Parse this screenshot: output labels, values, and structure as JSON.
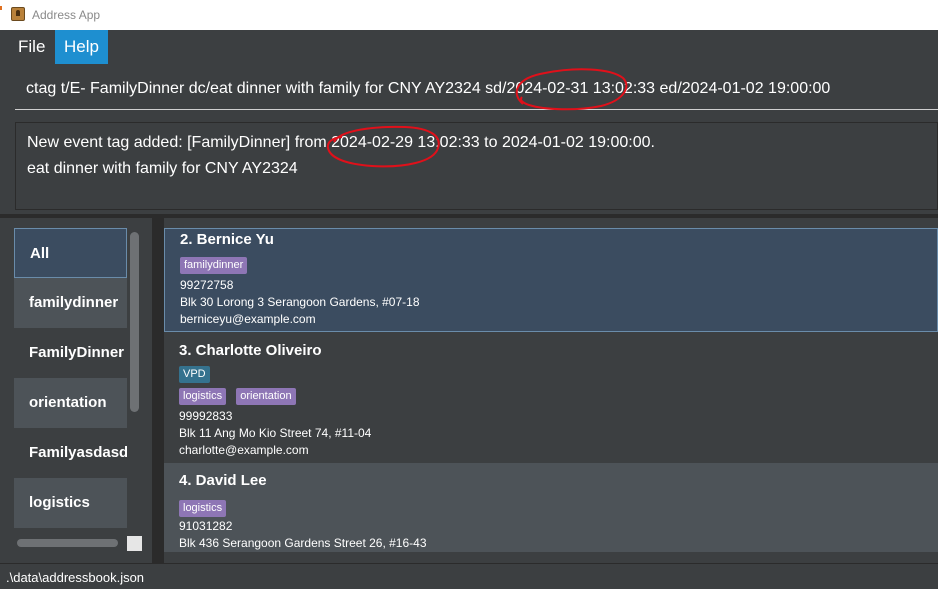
{
  "window": {
    "title": "Address App"
  },
  "menu": {
    "file": "File",
    "help": "Help"
  },
  "command": {
    "value": "ctag t/E- FamilyDinner dc/eat dinner with family for CNY AY2324 sd/2024-02-31 13:02:33 ed/2024-01-02 19:00:00"
  },
  "result": {
    "line1": "New event tag added: [FamilyDinner] from 2024-02-29 13:02:33 to 2024-01-02 19:00:00.",
    "line2": "eat dinner with family for CNY AY2324"
  },
  "annotation_color": "#e0101a",
  "tags": [
    "All",
    "familydinner",
    "FamilyDinner",
    "orientation",
    "Familyasdasd",
    "logistics"
  ],
  "persons": [
    {
      "name": "2.  Bernice Yu",
      "event_tags": [
        "familydinner"
      ],
      "other_tags": [],
      "phone": "99272758",
      "address": "Blk 30 Lorong 3 Serangoon Gardens, #07-18",
      "email": "berniceyu@example.com"
    },
    {
      "name": "3.  Charlotte Oliveiro",
      "event_tags": [
        "VPD"
      ],
      "other_tags": [
        "logistics",
        "orientation"
      ],
      "phone": "99992833",
      "address": "Blk 11 Ang Mo Kio Street 74, #11-04",
      "email": "charlotte@example.com"
    },
    {
      "name": "4.  David Lee",
      "event_tags": [
        "logistics"
      ],
      "other_tags": [],
      "phone": "91031282",
      "address": "Blk 436 Serangoon Gardens Street 26, #16-43",
      "email": ""
    }
  ],
  "status": {
    "path": ".\\data\\addressbook.json"
  }
}
